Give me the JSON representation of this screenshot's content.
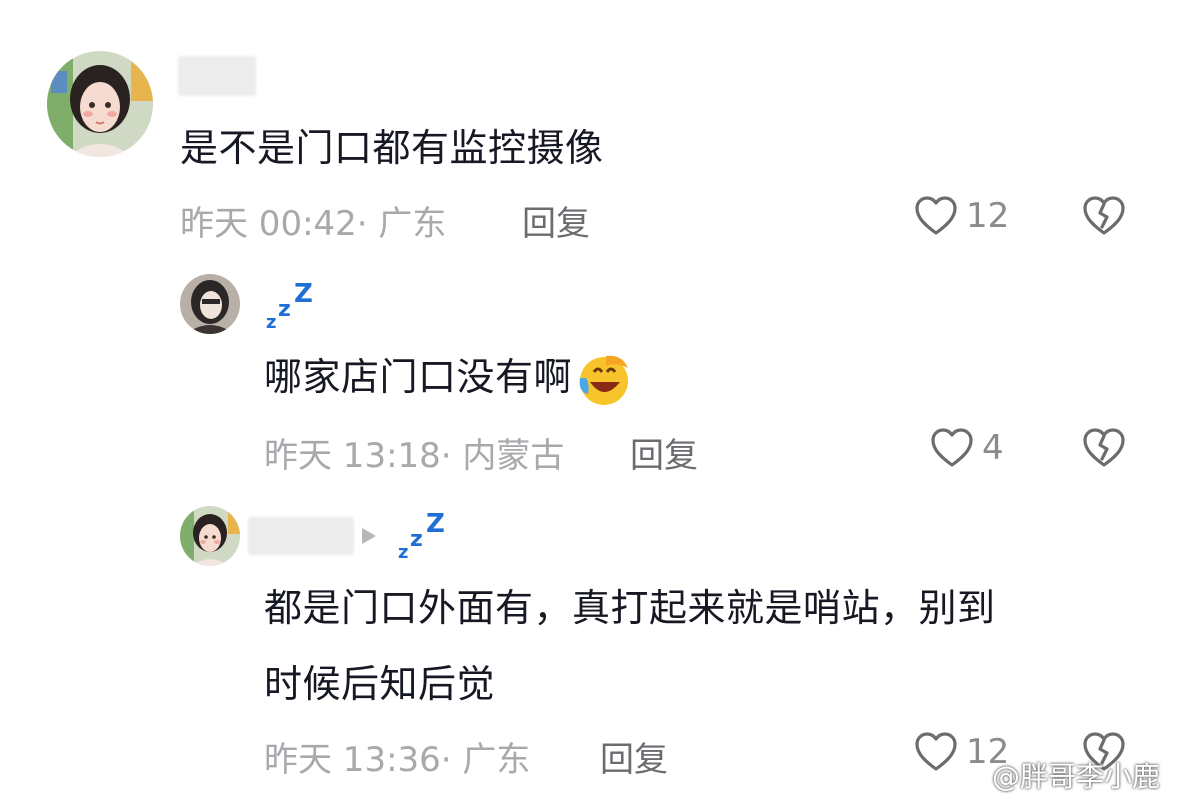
{
  "comments": [
    {
      "text": "是不是门口都有监控摄像",
      "time": "昨天 00:42",
      "location": "广东",
      "reply_label": "回复",
      "likes": "12"
    },
    {
      "text": "哪家店门口没有啊",
      "time": "昨天 13:18",
      "location": "内蒙古",
      "reply_label": "回复",
      "likes": "4"
    },
    {
      "text_line1": "都是门口外面有，真打起来就是哨站，别到",
      "text_line2": "时候后知后觉",
      "time": "昨天 13:36",
      "location": "广东",
      "reply_label": "回复",
      "likes": "12"
    }
  ],
  "separator": "·",
  "watermark": "@胖哥李小鹿",
  "colors": {
    "zzz": "#1f6fd6",
    "meta": "#a8a8ad",
    "text": "#161823"
  }
}
